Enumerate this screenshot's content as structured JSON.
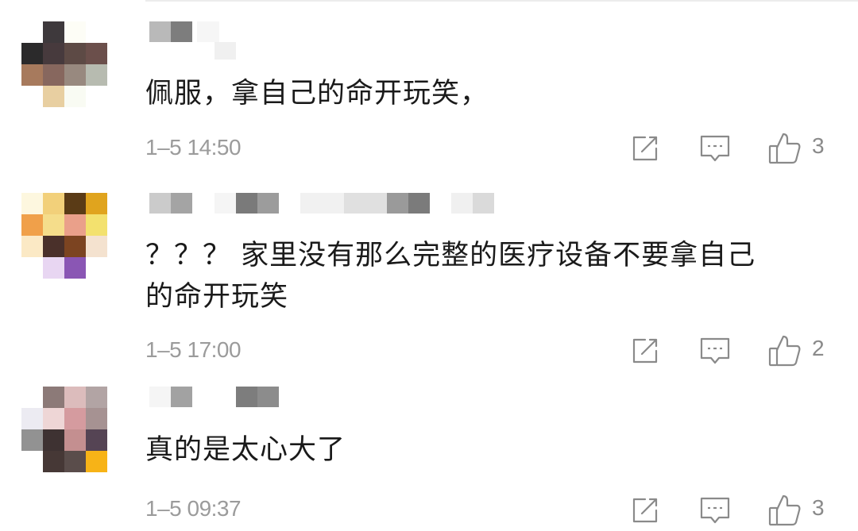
{
  "comments": [
    {
      "text": "佩服，拿自己的命开玩笑，",
      "time": "1–5 14:50",
      "likes": "3"
    },
    {
      "text": "？？？ 家里没有那么完整的医疗设备不要拿自己\n的命开玩笑",
      "time": "1–5 17:00",
      "likes": "2"
    },
    {
      "text": "真的是太心大了",
      "time": "1–5 09:37",
      "likes": "3"
    }
  ],
  "icons": {
    "share": "share-icon",
    "reply": "comment-icon",
    "like": "thumbs-up-icon"
  },
  "colors": {
    "text": "#1a1a1a",
    "meta": "#9b9b9b",
    "icon": "#8a8a8a"
  }
}
